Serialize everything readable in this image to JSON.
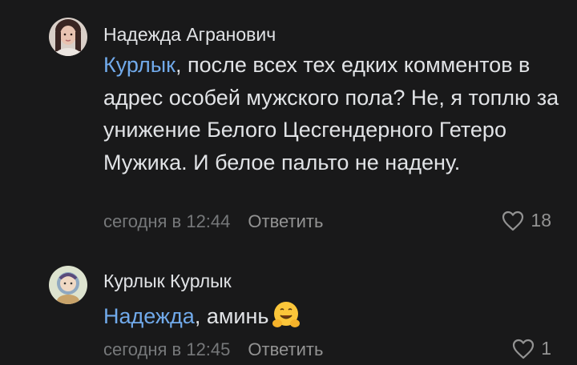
{
  "comments": [
    {
      "author": "Надежда Агранович",
      "mention": "Курлык",
      "text": ", после всех тех едких комментов в адрес особей мужского пола? Не, я топлю за унижение Белого Цесгендерного Гетеро Мужика. И белое пальто не надену.",
      "time": "сегодня в 12:44",
      "reply_label": "Ответить",
      "likes": "18",
      "avatar_icon": "user-avatar-photo"
    },
    {
      "author": "Курлык Курлык",
      "mention": "Надежда",
      "text": ", аминь",
      "emoji": "hugging-face-emoji",
      "time": "сегодня в 12:45",
      "reply_label": "Ответить",
      "likes": "1",
      "avatar_icon": "user-avatar-photo"
    }
  ],
  "colors": {
    "background": "#19191a",
    "text": "#e1e3e6",
    "link": "#71aaeb",
    "secondary": "#76787a"
  }
}
